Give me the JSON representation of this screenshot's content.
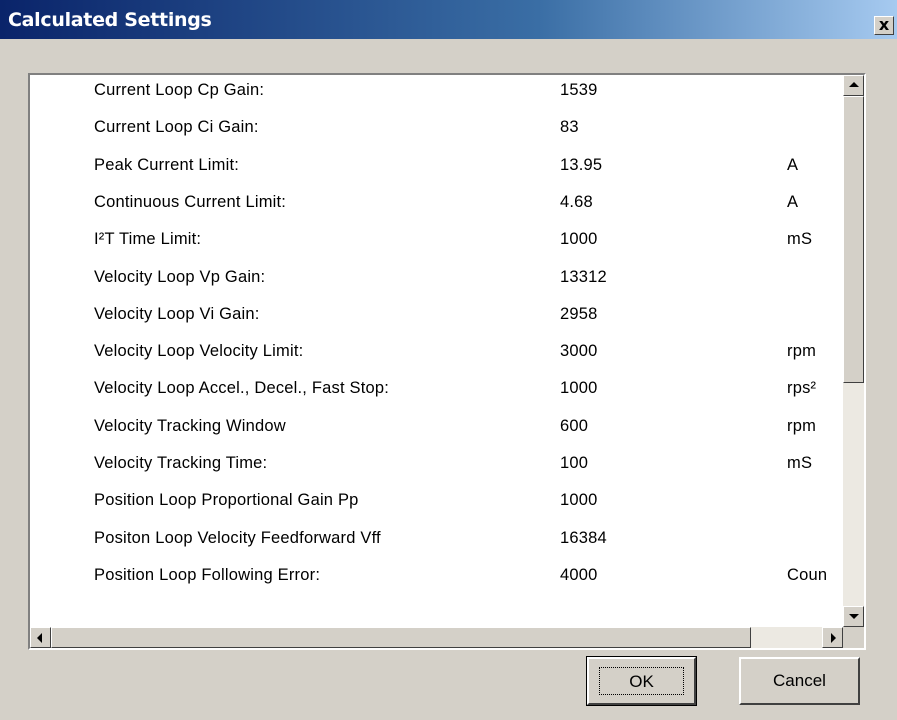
{
  "window": {
    "title": "Calculated Settings",
    "close_glyph": "x"
  },
  "settings": [
    {
      "label": "Current Loop Cp Gain:",
      "value": "1539",
      "unit": ""
    },
    {
      "label": "Current Loop Ci Gain:",
      "value": "83",
      "unit": ""
    },
    {
      "label": "Peak Current Limit:",
      "value": "13.95",
      "unit": "A"
    },
    {
      "label": "Continuous Current Limit:",
      "value": "4.68",
      "unit": "A"
    },
    {
      "label": "I²T Time Limit:",
      "value": "1000",
      "unit": "mS"
    },
    {
      "label": "Velocity Loop Vp Gain:",
      "value": "13312",
      "unit": ""
    },
    {
      "label": "Velocity Loop Vi Gain:",
      "value": "2958",
      "unit": ""
    },
    {
      "label": "Velocity Loop Velocity Limit:",
      "value": "3000",
      "unit": "rpm"
    },
    {
      "label": "Velocity Loop Accel., Decel., Fast Stop:",
      "value": "1000",
      "unit": "rps²"
    },
    {
      "label": "Velocity Tracking Window",
      "value": "600",
      "unit": "rpm"
    },
    {
      "label": "Velocity Tracking Time:",
      "value": "100",
      "unit": "mS"
    },
    {
      "label": "Position Loop Proportional Gain Pp",
      "value": "1000",
      "unit": ""
    },
    {
      "label": "Positon Loop Velocity Feedforward Vff",
      "value": "16384",
      "unit": ""
    },
    {
      "label": "Position Loop Following Error:",
      "value": "4000",
      "unit": "Coun"
    }
  ],
  "buttons": {
    "ok": "OK",
    "cancel": "Cancel"
  },
  "colors": {
    "title_bar_start": "#0a246a",
    "title_bar_end": "#a6caf0",
    "dialog_face": "#d4d0c8",
    "list_background": "#ffffff"
  }
}
